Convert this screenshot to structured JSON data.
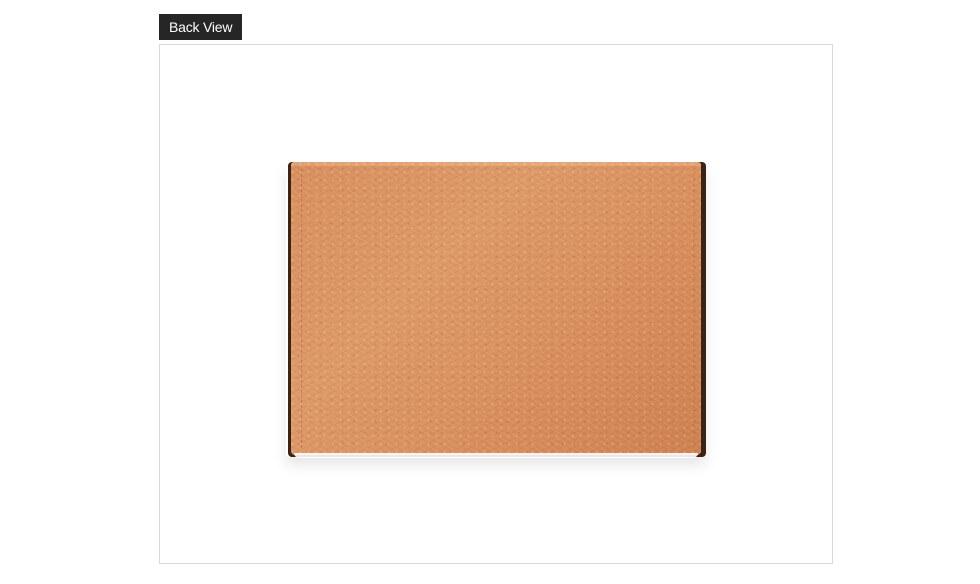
{
  "header": {
    "label": "Back View"
  },
  "product_image": {
    "icon": "wallet-back-image",
    "colors": {
      "leather": "#d98f5d",
      "edge": "#3b2416",
      "frame_border": "#d9d9d9",
      "label_background": "#262626"
    }
  }
}
